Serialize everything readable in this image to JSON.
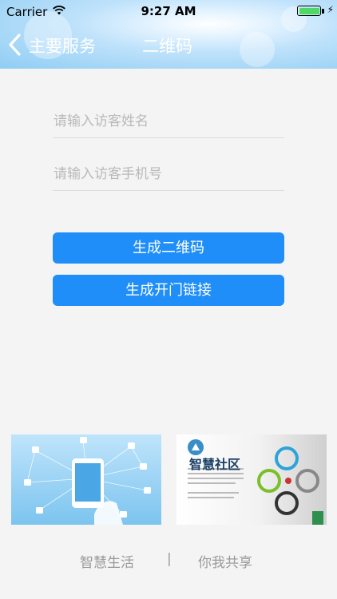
{
  "status_bar": {
    "carrier": "Carrier",
    "time": "9:27 AM"
  },
  "nav": {
    "back_label": "主要服务",
    "title": "二维码"
  },
  "form": {
    "name_placeholder": "请输入访客姓名",
    "phone_placeholder": "请输入访客手机号"
  },
  "buttons": {
    "generate_qr": "生成二维码",
    "generate_link": "生成开门链接"
  },
  "banners": {
    "community_title": "智慧社区"
  },
  "footer": {
    "left": "智慧生活",
    "divider": "|",
    "right": "你我共享"
  },
  "colors": {
    "accent": "#1f8ef8",
    "header": "#8fcdf3",
    "background": "#f4f4f4"
  }
}
